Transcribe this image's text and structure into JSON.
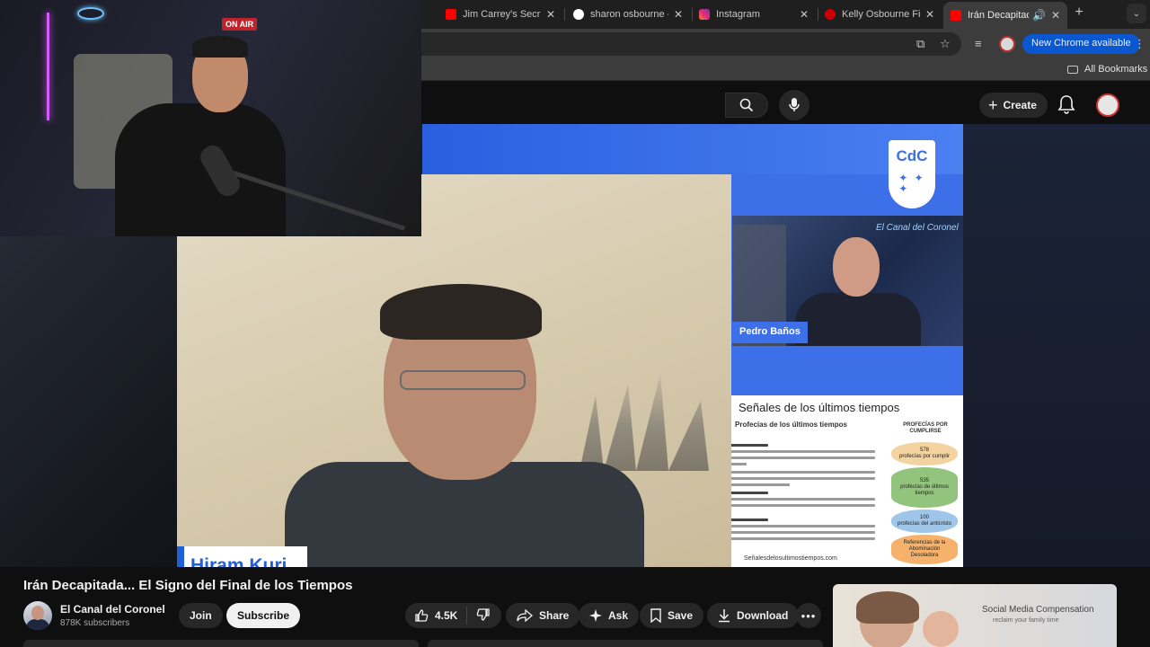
{
  "browser": {
    "tabs": [
      {
        "title": "Jim Carrey's Secre",
        "favicon": "youtube-icon",
        "color": "#ff0000"
      },
      {
        "title": "sharon osbourne -",
        "favicon": "google-icon",
        "color": "#ffffff"
      },
      {
        "title": "Instagram",
        "favicon": "instagram-icon",
        "color": "#d62976"
      },
      {
        "title": "Kelly Osbourne Fir",
        "favicon": "news-icon",
        "color": "#cc0000"
      },
      {
        "title": "Irán Decapitada",
        "favicon": "youtube-icon",
        "color": "#ff0000",
        "active": true
      }
    ],
    "new_chrome_label": "New Chrome available",
    "all_bookmarks_label": "All Bookmarks"
  },
  "youtube_header": {
    "create_label": "Create"
  },
  "video": {
    "overlay": {
      "on_air": "ON AIR",
      "guest_name": "Hiram Kuri",
      "host_name": "Pedro Baños",
      "logo_text": "CdC",
      "host_neon": "El Canal del Coronel",
      "doc_title": "Señales de los últimos tiempos",
      "doc_subtitle": "Profecías de los últimos tiempos",
      "doc_column_header": "PROFECÍAS POR CUMPLIRSE",
      "doc_stack": [
        {
          "value": "578",
          "label": "profecías por cumplir",
          "color": "#f3d3a0"
        },
        {
          "value": "535",
          "label": "profecías de últimos tiempos",
          "color": "#93c47d"
        },
        {
          "value": "100",
          "label": "profecías del anticristo",
          "color": "#9fc5e8"
        },
        {
          "value": "",
          "label": "Referencias de la Abominación Desoladora",
          "color": "#f6b26b"
        }
      ],
      "doc_footer": "Señalesdelosultimostiempos.com"
    }
  },
  "watch": {
    "title": "Irán Decapitada... El Signo del Final de los Tiempos",
    "channel_name": "El Canal del Coronel",
    "subscribers": "878K subscribers",
    "join_label": "Join",
    "subscribe_label": "Subscribe",
    "like_count": "4.5K",
    "share_label": "Share",
    "ask_label": "Ask",
    "save_label": "Save",
    "download_label": "Download",
    "ad": {
      "title": "Social Media Compensation",
      "subtitle": "reclaim your family time"
    }
  }
}
